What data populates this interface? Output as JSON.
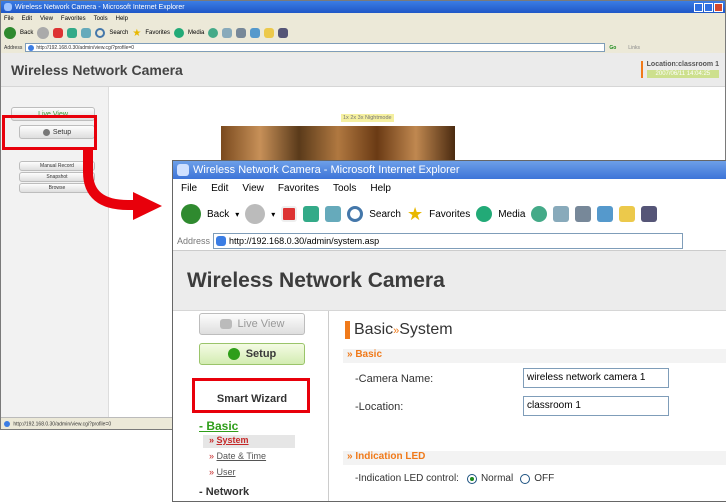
{
  "back_window": {
    "title": "Wireless Network Camera - Microsoft Internet Explorer",
    "menu": [
      "File",
      "Edit",
      "View",
      "Favorites",
      "Tools",
      "Help"
    ],
    "toolbar": {
      "back": "Back",
      "search": "Search",
      "favorites": "Favorites",
      "media": "Media"
    },
    "address_label": "Address",
    "address": "http://192.168.0.30/admin/view.cgi?profile=0",
    "go": "Go",
    "links": "Links",
    "header_title": "Wireless Network Camera",
    "location": "Location:classroom 1",
    "timestamp": "2007/06/11 14:04:25",
    "live_view": "Live View",
    "setup": "Setup",
    "sub_items": [
      "Manual Record",
      "Snapshot",
      "Browse"
    ],
    "zoom_links": "1x 2x 3x Nightmode",
    "status_url": "http://192.168.0.30/admin/view.cgi?profile=0"
  },
  "front_window": {
    "title": "Wireless Network Camera - Microsoft Internet Explorer",
    "menu": [
      "File",
      "Edit",
      "View",
      "Favorites",
      "Tools",
      "Help"
    ],
    "toolbar": {
      "back": "Back",
      "search": "Search",
      "favorites": "Favorites",
      "media": "Media"
    },
    "address_label": "Address",
    "address": "http://192.168.0.30/admin/system.asp",
    "header_title": "Wireless Network Camera",
    "live_view": "Live View",
    "setup": "Setup",
    "smart_wizard": "Smart Wizard",
    "basic_label": "- Basic",
    "basic_items": [
      "System",
      "Date & Time",
      "User"
    ],
    "network_label": "- Network",
    "page_title_main": "Basic",
    "page_title_sep": "»",
    "page_title_sub": "System",
    "section_basic": "» Basic",
    "camera_name_label": "-Camera Name:",
    "camera_name_value": "wireless network camera 1",
    "location_label": "-Location:",
    "location_value": "classroom 1",
    "section_led": "» Indication LED",
    "led_label": "-Indication LED control:",
    "led_normal": "Normal",
    "led_off": "OFF",
    "led_selected": "Normal"
  },
  "colors": {
    "accent": "#e8000b",
    "brand_orange": "#f07a1a",
    "setup_green": "#2f9e1a",
    "link_red": "#c62828"
  }
}
